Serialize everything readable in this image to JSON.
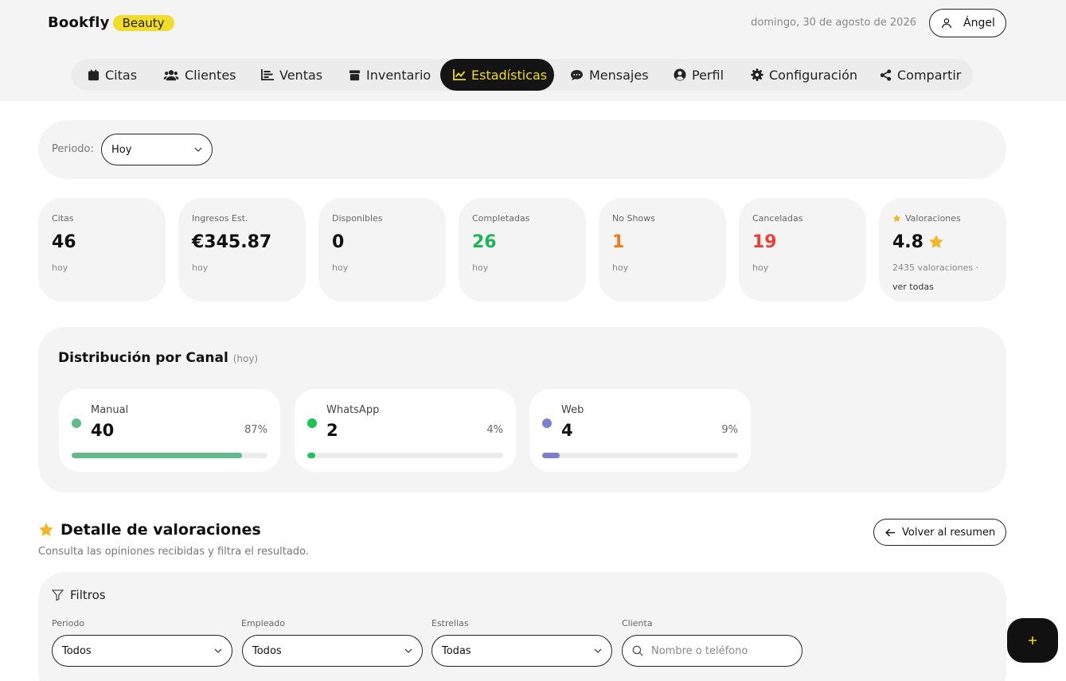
{
  "brand": {
    "name": "Bookfly",
    "badge": "Beauty"
  },
  "header": {
    "date": "domingo, 30 de agosto de 2026",
    "user_name": "Ángel"
  },
  "nav": [
    {
      "label": "Citas",
      "icon": "calendar-icon"
    },
    {
      "label": "Clientes",
      "icon": "users-icon"
    },
    {
      "label": "Ventas",
      "icon": "bar-chart-icon"
    },
    {
      "label": "Inventario",
      "icon": "box-icon"
    },
    {
      "label": "Estadísticas",
      "icon": "line-chart-icon",
      "active": true
    },
    {
      "label": "Mensajes",
      "icon": "chat-icon"
    },
    {
      "label": "Perfil",
      "icon": "user-circle-icon"
    },
    {
      "label": "Configuración",
      "icon": "gear-icon"
    },
    {
      "label": "Compartir",
      "icon": "share-icon"
    }
  ],
  "period": {
    "label": "Periodo:",
    "value": "Hoy"
  },
  "stats": [
    {
      "label": "Citas",
      "value": "46",
      "sub": "hoy",
      "color": "#111111"
    },
    {
      "label": "Ingresos Est.",
      "value": "€345.87",
      "sub": "hoy",
      "color": "#111111"
    },
    {
      "label": "Disponibles",
      "value": "0",
      "sub": "hoy",
      "color": "#111111"
    },
    {
      "label": "Completadas",
      "value": "26",
      "sub": "hoy",
      "color": "#1fb35a"
    },
    {
      "label": "No Shows",
      "value": "1",
      "sub": "hoy",
      "color": "#f07a1c"
    },
    {
      "label": "Canceladas",
      "value": "19",
      "sub": "hoy",
      "color": "#e8403a"
    }
  ],
  "ratings": {
    "label": "Valoraciones",
    "value": "4.8",
    "count_text": "2435 valoraciones",
    "separator": "·",
    "link": "ver todas"
  },
  "distribution": {
    "title": "Distribución por Canal",
    "period": "(hoy)",
    "channels": [
      {
        "name": "Manual",
        "count": "40",
        "pct_label": "87%",
        "fill": 0.87,
        "color": "#63b98a"
      },
      {
        "name": "WhatsApp",
        "count": "2",
        "pct_label": "4%",
        "fill": 0.04,
        "color": "#1ec15a"
      },
      {
        "name": "Web",
        "count": "4",
        "pct_label": "9%",
        "fill": 0.09,
        "color": "#7e7ed0"
      }
    ]
  },
  "detail": {
    "title": "Detalle de valoraciones",
    "subtitle": "Consulta las opiniones recibidas y filtra el resultado.",
    "back_label": "Volver al resumen"
  },
  "filters": {
    "title": "Filtros",
    "period": {
      "label": "Periodo",
      "value": "Todos"
    },
    "employee": {
      "label": "Empleado",
      "value": "Todos"
    },
    "stars": {
      "label": "Estrellas",
      "value": "Todas"
    },
    "client": {
      "label": "Clienta",
      "placeholder": "Nombre o teléfono"
    }
  },
  "colors": {
    "accent": "#f4d924",
    "star": "#f2b62b"
  }
}
